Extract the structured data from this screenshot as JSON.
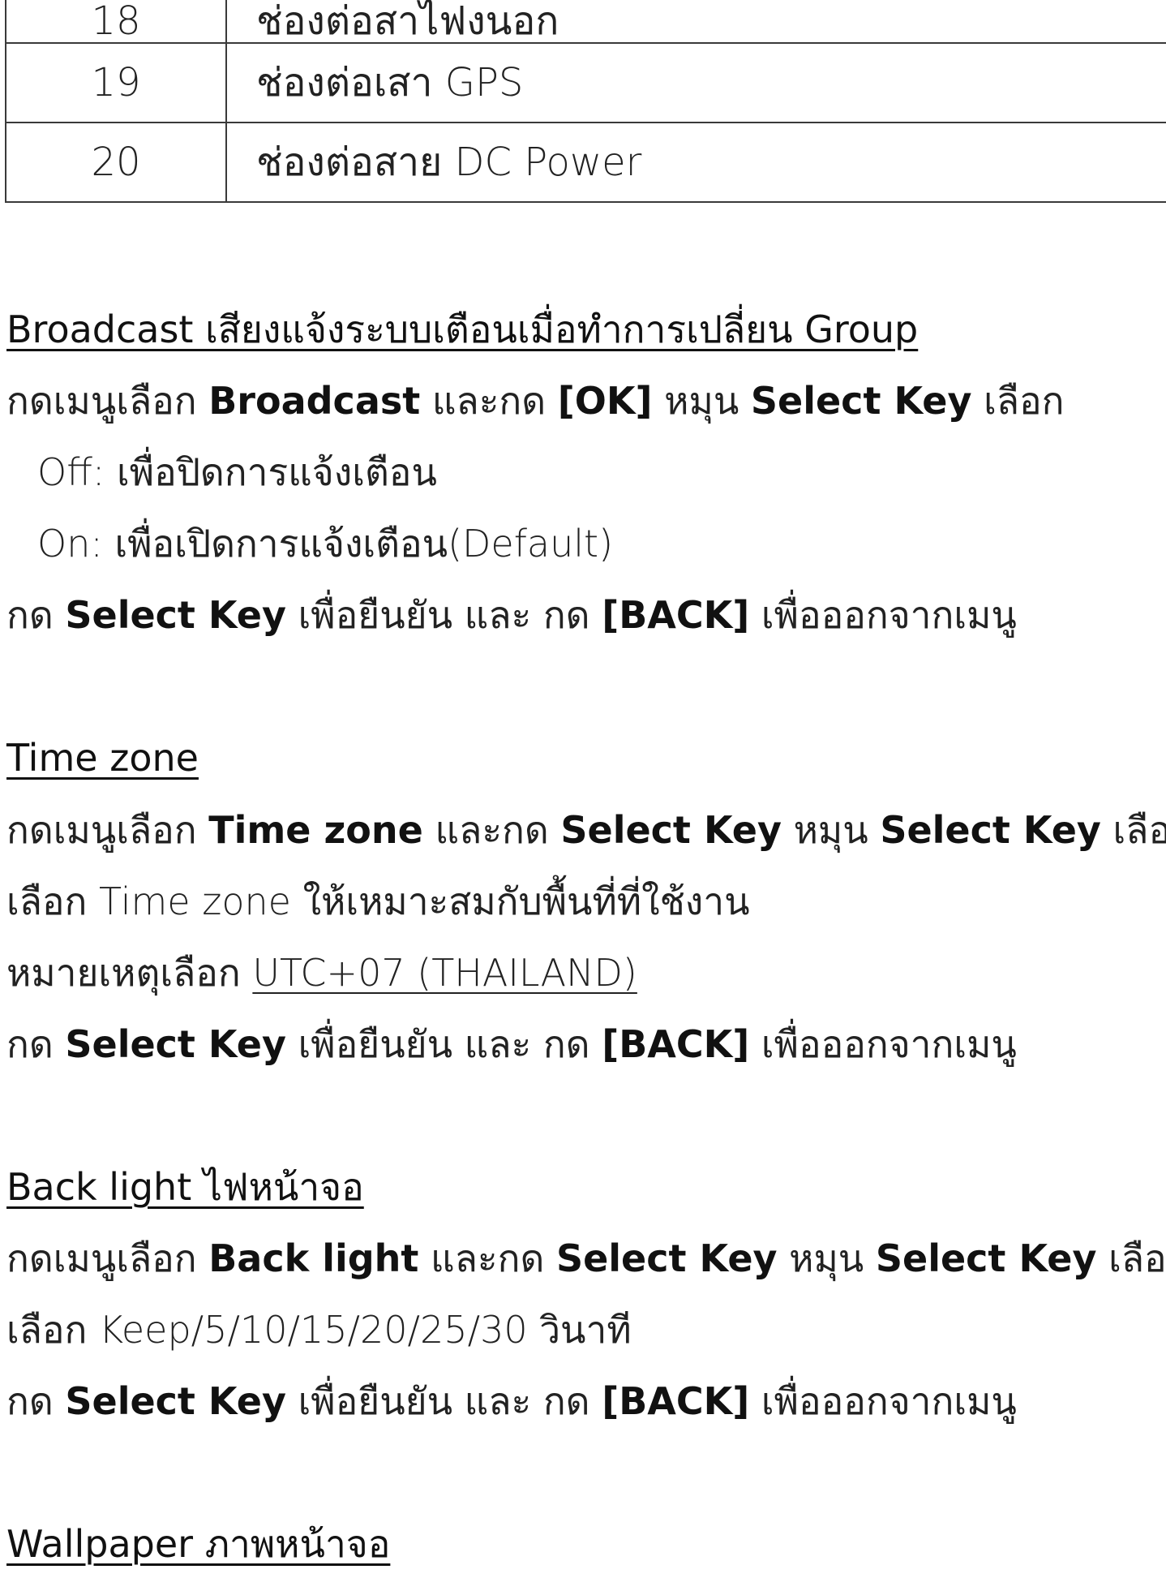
{
  "table": {
    "rows": [
      {
        "num": "18",
        "desc": "ช่องต่อสาไฟงนอก"
      },
      {
        "num": "19",
        "desc": "ช่องต่อเสา GPS"
      },
      {
        "num": "20",
        "desc": "ช่องต่อสาย DC Power"
      }
    ]
  },
  "broadcast": {
    "heading": "Broadcast เสียงแจ้งระบบเตือนเมื่อทำการเปลี่ยน Group",
    "l1": {
      "t1": "กดเมนูเลือก ",
      "k1": "Broadcast",
      "t2": " และกด ",
      "k2": "[OK]",
      "t3": " หมุน ",
      "k3": "Select Key",
      "t4": " เลือก"
    },
    "off": "Off: เพื่อปิดการแจ้งเตือน",
    "on": "On: เพื่อเปิดการแจ้งเตือน(Default)",
    "confirm": {
      "t1": "กด ",
      "k1": "Select Key",
      "t2": " เพื่อยืนยัน และ กด ",
      "k2": "[BACK]",
      "t3": " เพื่อออกจากเมนู"
    }
  },
  "timezone": {
    "heading": "Time zone",
    "l1": {
      "t1": "กดเมนูเลือก ",
      "k1": "Time zone",
      "t2": " และกด ",
      "k2": "Select Key",
      "t3": " หมุน ",
      "k3": "Select Key",
      "t4": " เลือก"
    },
    "l2": "เลือก Time zone ให้เหมาะสมกับพื้นที่ที่ใช้งาน",
    "note": {
      "t1": "หมายเหตุเลือก ",
      "u1": "UTC+07 (THAILAND)"
    },
    "confirm": {
      "t1": "กด ",
      "k1": "Select Key",
      "t2": " เพื่อยืนยัน และ กด ",
      "k2": "[BACK]",
      "t3": " เพื่อออกจากเมนู"
    }
  },
  "backlight": {
    "heading": "Back light ไฟหน้าจอ",
    "l1": {
      "t1": "กดเมนูเลือก ",
      "k1": "Back light",
      "t2": " และกด ",
      "k2": "Select Key",
      "t3": " หมุน ",
      "k3": "Select Key",
      "t4": " เลือก"
    },
    "l2": "เลือก Keep/5/10/15/20/25/30 วินาที",
    "confirm": {
      "t1": "กด ",
      "k1": "Select Key",
      "t2": " เพื่อยืนยัน และ กด ",
      "k2": "[BACK]",
      "t3": " เพื่อออกจากเมนู"
    }
  },
  "wallpaper": {
    "heading": "Wallpaper ภาพหน้าจอ"
  }
}
